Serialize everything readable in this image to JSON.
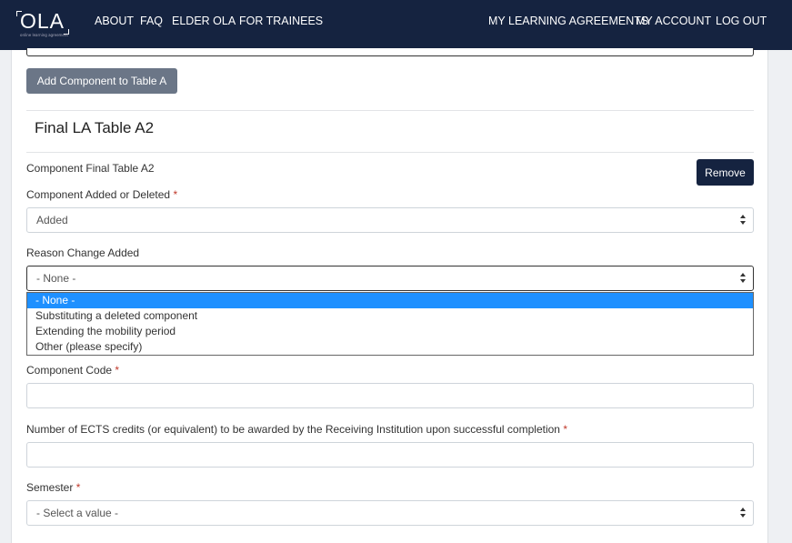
{
  "header": {
    "logo_text": "OLA",
    "logo_subtitle": "online learning agreement",
    "nav_left": [
      "ABOUT",
      "FAQ",
      "ELDER OLA",
      "FOR TRAINEES"
    ],
    "nav_right": [
      "MY LEARNING AGREEMENTS",
      "MY ACCOUNT",
      "LOG OUT"
    ]
  },
  "form": {
    "add_component_label": "Add Component to Table A",
    "section_title": "Final LA Table A2",
    "component_label": "Component Final Table A2",
    "remove_label": "Remove",
    "added_deleted": {
      "label": "Component Added or Deleted",
      "required_mark": "*",
      "value": "Added"
    },
    "reason_change": {
      "label": "Reason Change Added",
      "value": "- None -",
      "options": [
        "- None -",
        "Substituting a deleted component",
        "Extending the mobility period",
        "Other (please specify)"
      ]
    },
    "component_code": {
      "label": "Component Code",
      "required_mark": "*",
      "value": ""
    },
    "ects_credits": {
      "label": "Number of ECTS credits (or equivalent) to be awarded by the Receiving Institution upon successful completion",
      "required_mark": "*",
      "value": ""
    },
    "semester": {
      "label": "Semester",
      "required_mark": "*",
      "value": "- Select a value -"
    }
  },
  "colors": {
    "navbar": "#152340",
    "add_button": "#6b7687",
    "remove_button": "#152340",
    "option_highlight": "#1e90ff",
    "required": "#c0392b"
  }
}
